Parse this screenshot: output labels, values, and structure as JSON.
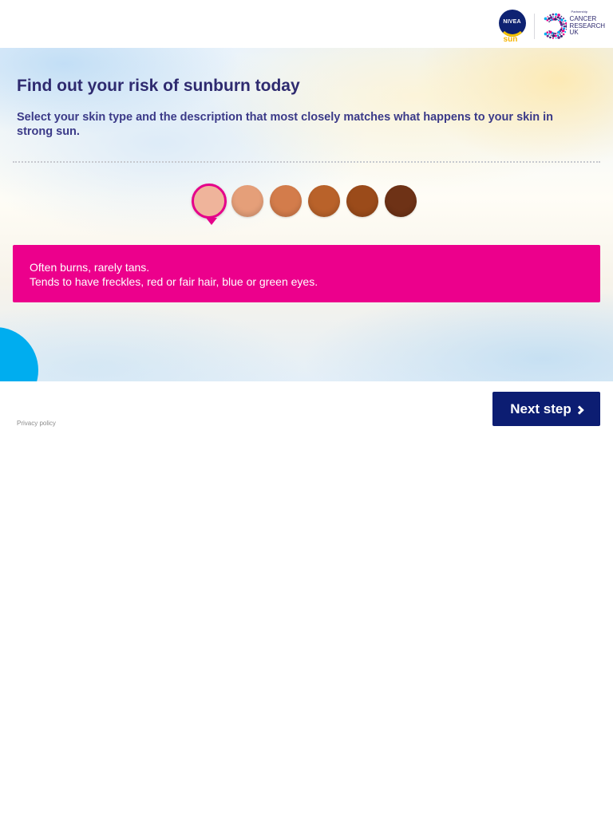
{
  "header": {
    "nivea_logo_text": "NIVEA",
    "nivea_sun_text": "sun",
    "partner_tagline": "Partnership",
    "cruk_lines": [
      "CANCER",
      "RESEARCH",
      "UK"
    ]
  },
  "main": {
    "title": "Find out your risk of sunburn today",
    "subtitle": "Select your skin type and the description that most closely matches what happens to your skin in strong sun.",
    "skin_types": [
      {
        "color": "#efb49b",
        "selected": true
      },
      {
        "color": "#e59f79",
        "selected": false
      },
      {
        "color": "#d37c4b",
        "selected": false
      },
      {
        "color": "#b9622a",
        "selected": false
      },
      {
        "color": "#9b4b1a",
        "selected": false
      },
      {
        "color": "#6e3216",
        "selected": false
      }
    ],
    "description": {
      "line1": "Often burns, rarely tans.",
      "line2": "Tends to have freckles, red or fair hair, blue or green eyes."
    }
  },
  "footer": {
    "next_label": "Next step",
    "privacy_label": "Privacy policy"
  },
  "colors": {
    "brand_navy": "#0c1d72",
    "accent_pink": "#ec008c",
    "heading_purple": "#2e2a6f",
    "ball_blue": "#00adef"
  }
}
